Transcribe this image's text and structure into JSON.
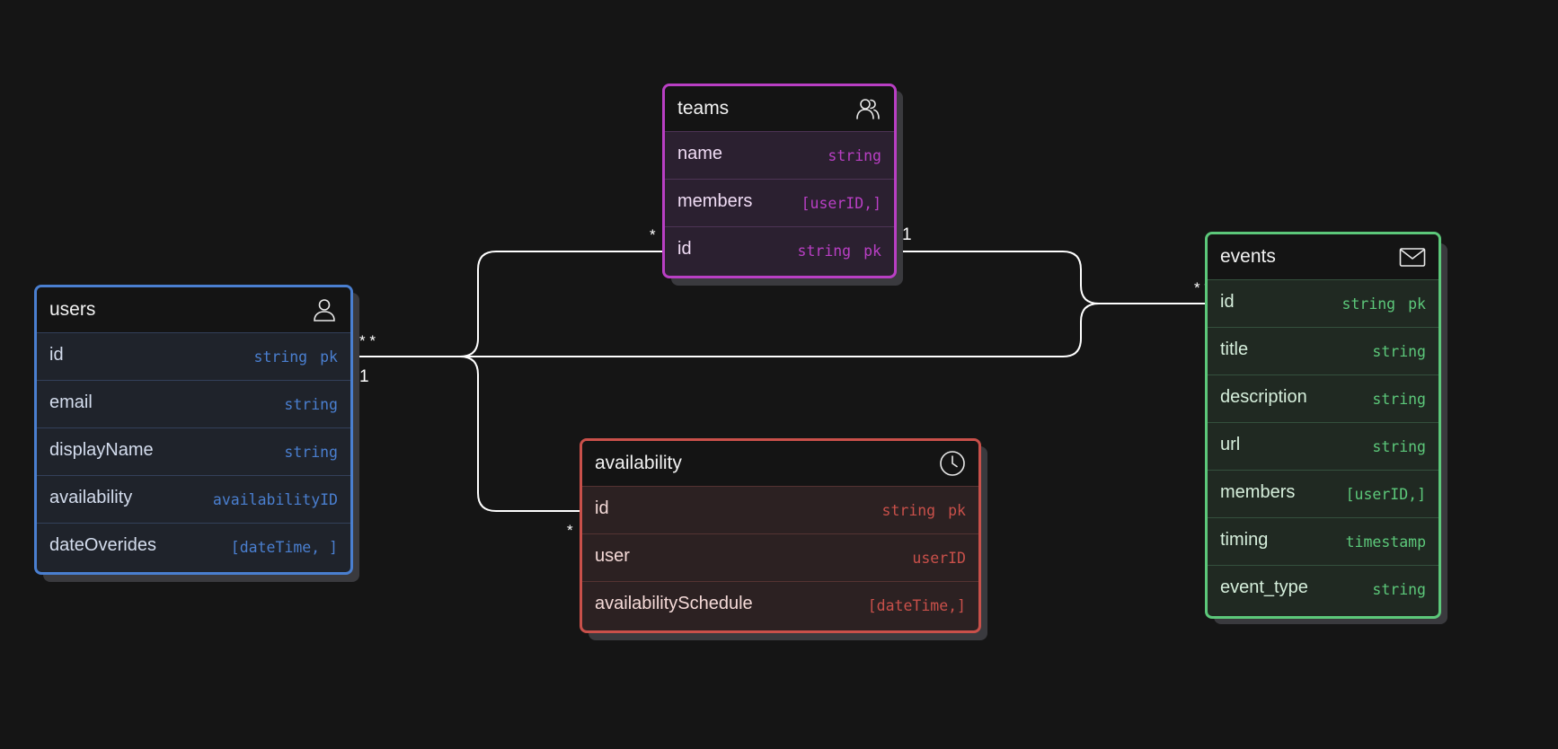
{
  "tables": {
    "teams": {
      "name": "teams",
      "icon": "users-group-icon",
      "rows": [
        {
          "name": "name",
          "type": "string",
          "pk": ""
        },
        {
          "name": "members",
          "type": "[userID,]",
          "pk": ""
        },
        {
          "name": "id",
          "type": "string",
          "pk": "pk"
        }
      ]
    },
    "users": {
      "name": "users",
      "icon": "user-icon",
      "rows": [
        {
          "name": "id",
          "type": "string",
          "pk": "pk"
        },
        {
          "name": "email",
          "type": "string",
          "pk": ""
        },
        {
          "name": "displayName",
          "type": "string",
          "pk": ""
        },
        {
          "name": "availability",
          "type": "availabilityID",
          "pk": ""
        },
        {
          "name": "dateOverides",
          "type": "[dateTime, ]",
          "pk": ""
        }
      ]
    },
    "events": {
      "name": "events",
      "icon": "mail-icon",
      "rows": [
        {
          "name": "id",
          "type": "string",
          "pk": "pk"
        },
        {
          "name": "title",
          "type": "string",
          "pk": ""
        },
        {
          "name": "description",
          "type": "string",
          "pk": ""
        },
        {
          "name": "url",
          "type": "string",
          "pk": ""
        },
        {
          "name": "members",
          "type": "[userID,]",
          "pk": ""
        },
        {
          "name": "timing",
          "type": "timestamp",
          "pk": ""
        },
        {
          "name": "event_type",
          "type": "string",
          "pk": ""
        }
      ]
    },
    "availability": {
      "name": "availability",
      "icon": "clock-icon",
      "rows": [
        {
          "name": "id",
          "type": "string",
          "pk": "pk"
        },
        {
          "name": "user",
          "type": "userID",
          "pk": ""
        },
        {
          "name": "availabilitySchedule",
          "type": "[dateTime,]",
          "pk": ""
        }
      ]
    }
  },
  "cardinality": {
    "teams_id_left": "*",
    "teams_id_right": "1",
    "users_id_many": "* *",
    "users_id_one": "1",
    "events_id_many": "* *",
    "availability_id_many": "*"
  },
  "colors": {
    "background": "#151515",
    "users": "#4a7fd0",
    "teams": "#b93fc4",
    "events": "#5cc87a",
    "availability": "#c9504a",
    "connector": "#ffffff"
  }
}
